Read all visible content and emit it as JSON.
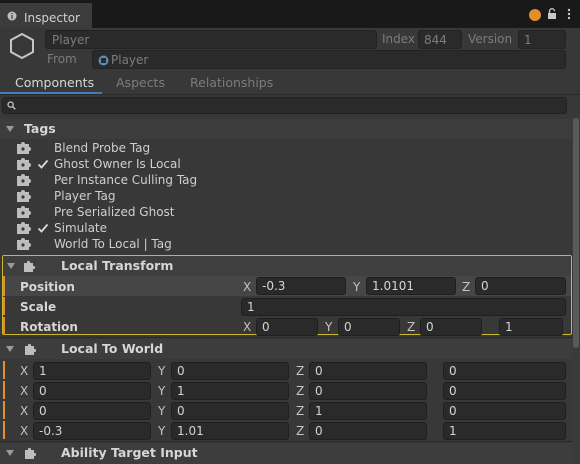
{
  "window": {
    "tab_title": "Inspector",
    "accent_dot_color": "#e08f2b"
  },
  "header": {
    "entity_name": "Player",
    "index_label": "Index",
    "index_value": "844",
    "version_label": "Version",
    "version_value": "1",
    "from_label": "From",
    "from_value": "Player"
  },
  "tabs": [
    {
      "label": "Components",
      "active": true
    },
    {
      "label": "Aspects",
      "active": false
    },
    {
      "label": "Relationships",
      "active": false
    }
  ],
  "search": {
    "placeholder": ""
  },
  "tags": {
    "title": "Tags",
    "items": [
      {
        "label": "Blend Probe Tag",
        "checked": false
      },
      {
        "label": "Ghost Owner Is Local",
        "checked": true
      },
      {
        "label": "Per Instance Culling Tag",
        "checked": false
      },
      {
        "label": "Player Tag",
        "checked": false
      },
      {
        "label": "Pre Serialized Ghost",
        "checked": false
      },
      {
        "label": "Simulate",
        "checked": true
      },
      {
        "label": "World To Local | Tag",
        "checked": false
      }
    ]
  },
  "local_transform": {
    "title": "Local Transform",
    "position_label": "Position",
    "position": {
      "x": "-0.3",
      "y": "1.0101",
      "z": "0"
    },
    "scale_label": "Scale",
    "scale": "1",
    "rotation_label": "Rotation",
    "rotation": {
      "x": "0",
      "y": "0",
      "z": "0",
      "w": "1"
    }
  },
  "local_to_world": {
    "title": "Local To World",
    "rows": [
      [
        "1",
        "0",
        "0",
        "0"
      ],
      [
        "0",
        "1",
        "0",
        "0"
      ],
      [
        "0",
        "0",
        "1",
        "0"
      ],
      [
        "-0.3",
        "1.01",
        "0",
        "1"
      ]
    ]
  },
  "ability_target_input": {
    "title": "Ability Target Input"
  },
  "axis_labels": {
    "x": "X",
    "y": "Y",
    "z": "Z"
  }
}
